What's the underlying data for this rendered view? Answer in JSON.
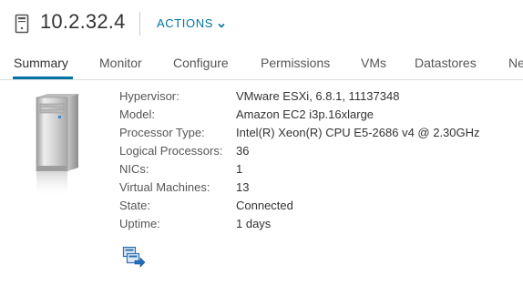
{
  "header": {
    "host_name": "10.2.32.4",
    "actions_label": "ACTIONS"
  },
  "tabs": [
    {
      "label": "Summary",
      "active": true
    },
    {
      "label": "Monitor"
    },
    {
      "label": "Configure"
    },
    {
      "label": "Permissions"
    },
    {
      "label": "VMs"
    },
    {
      "label": "Datastores"
    },
    {
      "label": "Ne"
    }
  ],
  "properties": [
    {
      "label": "Hypervisor:",
      "value": "VMware ESXi, 6.8.1, 11137348"
    },
    {
      "label": "Model:",
      "value": "Amazon EC2 i3p.16xlarge"
    },
    {
      "label": "Processor Type:",
      "value": "Intel(R) Xeon(R) CPU E5-2686 v4 @ 2.30GHz"
    },
    {
      "label": "Logical Processors:",
      "value": "36"
    },
    {
      "label": "NICs:",
      "value": "1"
    },
    {
      "label": "Virtual Machines:",
      "value": "13"
    },
    {
      "label": "State:",
      "value": "Connected"
    },
    {
      "label": "Uptime:",
      "value": "1 days"
    }
  ],
  "icons": {
    "host": "host-icon",
    "actions_chevron": "chevron-down-icon",
    "server_image": "server-tower-icon",
    "migrate": "migrate-host-icon"
  },
  "colors": {
    "accent": "#0072a3",
    "text": "#333333",
    "label": "#565656"
  }
}
